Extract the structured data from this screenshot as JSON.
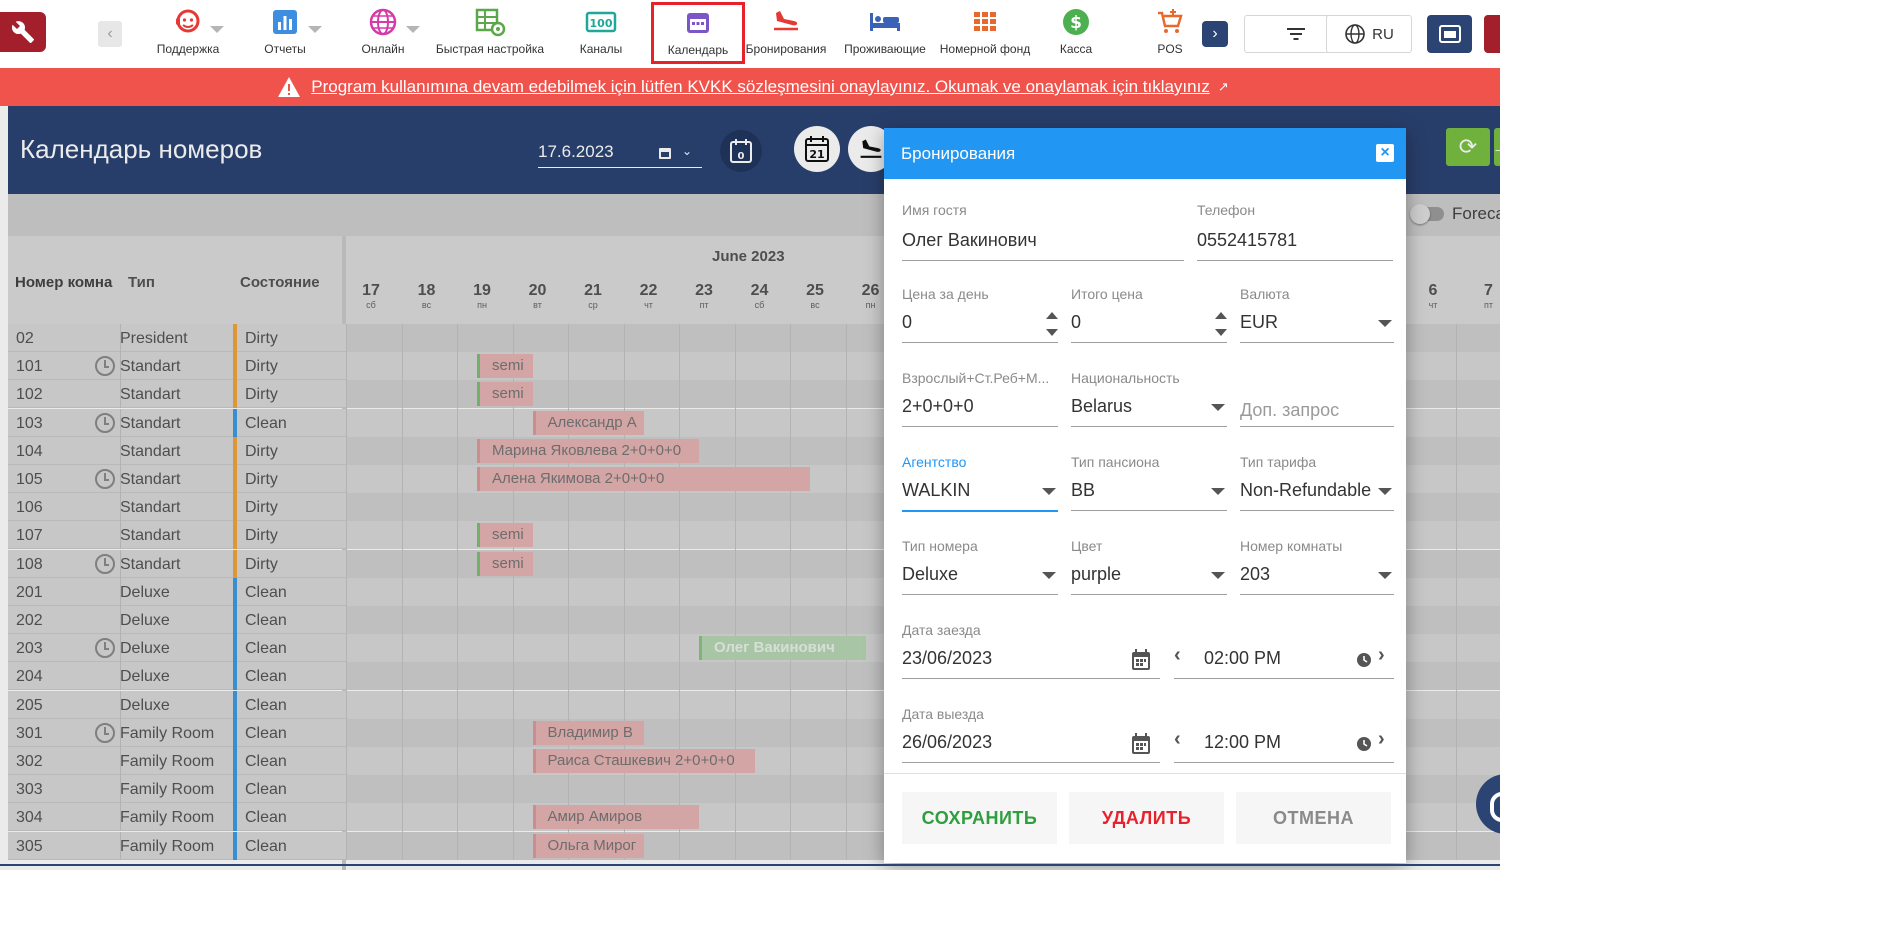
{
  "toolbar": {
    "nav_items": [
      {
        "label": "Поддержка",
        "icon": "support-agent-icon"
      },
      {
        "label": "Отчеты",
        "icon": "bar-chart-icon"
      },
      {
        "label": "Онлайн",
        "icon": "globe-icon"
      },
      {
        "label": "Быстрая настройка",
        "icon": "quick-settings-icon"
      },
      {
        "label": "Каналы",
        "icon": "channel-counter-icon"
      },
      {
        "label": "Календарь",
        "icon": "calendar-icon"
      },
      {
        "label": "Бронирования",
        "icon": "flight-landing-icon"
      },
      {
        "label": "Проживающие",
        "icon": "bed-icon"
      },
      {
        "label": "Номерной фонд",
        "icon": "grid-icon"
      },
      {
        "label": "Касса",
        "icon": "dollar-icon"
      },
      {
        "label": "POS",
        "icon": "cart-add-icon"
      }
    ],
    "language": "RU"
  },
  "banner": {
    "message": "Program kullanımına devam edebilmek için lütfen KVKK sözleşmesini onaylayınız. Okumak ve onaylamak için tıklayınız"
  },
  "header": {
    "title": "Календарь номеров",
    "date": "17.6.2023",
    "today_badge": "0",
    "calendar_badge": "21"
  },
  "filter": {
    "forecast_label": "Foreca"
  },
  "grid": {
    "col_room": "Номер комна",
    "col_type": "Тип",
    "col_status": "Состояние",
    "month": "June 2023",
    "days": [
      {
        "n": "17",
        "w": "сб"
      },
      {
        "n": "18",
        "w": "вс"
      },
      {
        "n": "19",
        "w": "пн"
      },
      {
        "n": "20",
        "w": "вт"
      },
      {
        "n": "21",
        "w": "ср"
      },
      {
        "n": "22",
        "w": "чт"
      },
      {
        "n": "23",
        "w": "пт"
      },
      {
        "n": "24",
        "w": "сб"
      },
      {
        "n": "25",
        "w": "вс"
      },
      {
        "n": "26",
        "w": "пн"
      }
    ],
    "days_right": [
      {
        "n": "6",
        "w": "чт"
      },
      {
        "n": "7",
        "w": "пт"
      }
    ],
    "rows": [
      {
        "room": "02",
        "type": "President",
        "status": "Dirty",
        "clock": false
      },
      {
        "room": "101",
        "type": "Standart",
        "status": "Dirty",
        "clock": true
      },
      {
        "room": "102",
        "type": "Standart",
        "status": "Dirty",
        "clock": false
      },
      {
        "room": "103",
        "type": "Standart",
        "status": "Clean",
        "clock": true
      },
      {
        "room": "104",
        "type": "Standart",
        "status": "Dirty",
        "clock": false
      },
      {
        "room": "105",
        "type": "Standart",
        "status": "Dirty",
        "clock": true
      },
      {
        "room": "106",
        "type": "Standart",
        "status": "Dirty",
        "clock": false
      },
      {
        "room": "107",
        "type": "Standart",
        "status": "Dirty",
        "clock": false
      },
      {
        "room": "108",
        "type": "Standart",
        "status": "Dirty",
        "clock": true
      },
      {
        "room": "201",
        "type": "Deluxe",
        "status": "Clean",
        "clock": false
      },
      {
        "room": "202",
        "type": "Deluxe",
        "status": "Clean",
        "clock": false
      },
      {
        "room": "203",
        "type": "Deluxe",
        "status": "Clean",
        "clock": true
      },
      {
        "room": "204",
        "type": "Deluxe",
        "status": "Clean",
        "clock": false
      },
      {
        "room": "205",
        "type": "Deluxe",
        "status": "Clean",
        "clock": false
      },
      {
        "room": "301",
        "type": "Family Room",
        "status": "Clean",
        "clock": true
      },
      {
        "room": "302",
        "type": "Family Room",
        "status": "Clean",
        "clock": false
      },
      {
        "room": "303",
        "type": "Family Room",
        "status": "Clean",
        "clock": false
      },
      {
        "room": "304",
        "type": "Family Room",
        "status": "Clean",
        "clock": false
      },
      {
        "room": "305",
        "type": "Family Room",
        "status": "Clean",
        "clock": false
      }
    ],
    "bookings": [
      {
        "row": 1,
        "start": 2,
        "nights": 1,
        "text": "semi",
        "variant": "greenleft"
      },
      {
        "row": 2,
        "start": 2,
        "nights": 1,
        "text": "semi",
        "variant": "greenleft"
      },
      {
        "row": 3,
        "start": 3,
        "nights": 2,
        "text": "Александр А",
        "variant": ""
      },
      {
        "row": 4,
        "start": 2,
        "nights": 4,
        "text": "Марина Яковлева 2+0+0+0",
        "variant": ""
      },
      {
        "row": 5,
        "start": 2,
        "nights": 6,
        "text": "Алена Якимова 2+0+0+0",
        "variant": ""
      },
      {
        "row": 7,
        "start": 2,
        "nights": 1,
        "text": "semi",
        "variant": "greenleft"
      },
      {
        "row": 8,
        "start": 2,
        "nights": 1,
        "text": "semi",
        "variant": "greenleft"
      },
      {
        "row": 11,
        "start": 6,
        "nights": 3,
        "text": "Олег Вакинович",
        "variant": "green"
      },
      {
        "row": 14,
        "start": 3,
        "nights": 2,
        "text": "Владимир В",
        "variant": ""
      },
      {
        "row": 15,
        "start": 3,
        "nights": 4,
        "text": "Раиса Сташкевич 2+0+0+0",
        "variant": ""
      },
      {
        "row": 17,
        "start": 3,
        "nights": 3,
        "text": "Амир Амиров",
        "variant": ""
      },
      {
        "row": 18,
        "start": 3,
        "nights": 2,
        "text": "Ольга Мирог",
        "variant": ""
      }
    ]
  },
  "modal": {
    "title": "Бронирования",
    "guest_name_label": "Имя гостя",
    "guest_name": "Олег Вакинович",
    "phone_label": "Телефон",
    "phone": "0552415781",
    "price_day_label": "Цена за день",
    "price_day": "0",
    "total_label": "Итого цена",
    "total": "0",
    "currency_label": "Валюта",
    "currency": "EUR",
    "guests_label": "Взрослый+Ст.Реб+М...",
    "guests": "2+0+0+0",
    "nationality_label": "Национальность",
    "nationality": "Belarus",
    "extra_request_placeholder": "Доп. запрос",
    "agency_label": "Агентство",
    "agency": "WALKIN",
    "board_label": "Тип пансиона",
    "board": "BB",
    "rate_label": "Тип тарифа",
    "rate": "Non-Refundable",
    "room_type_label": "Тип номера",
    "room_type": "Deluxe",
    "color_label": "Цвет",
    "color": "purple",
    "room_no_label": "Номер комнаты",
    "room_no": "203",
    "checkin_label": "Дата заезда",
    "checkin_date": "23/06/2023",
    "checkin_time": "02:00 PM",
    "checkout_label": "Дата выезда",
    "checkout_date": "26/06/2023",
    "checkout_time": "12:00 PM",
    "save": "СОХРАНИТЬ",
    "delete": "УДАЛИТЬ",
    "cancel": "ОТМЕНА"
  },
  "colors": {
    "primary_dark": "#2c4473",
    "accent_blue": "#2196f3",
    "banner_red": "#f0524c",
    "dirty": "#f0a43a",
    "clean": "#3d9be0",
    "save_green": "#2e9e3e",
    "delete_red": "#e8222b"
  }
}
